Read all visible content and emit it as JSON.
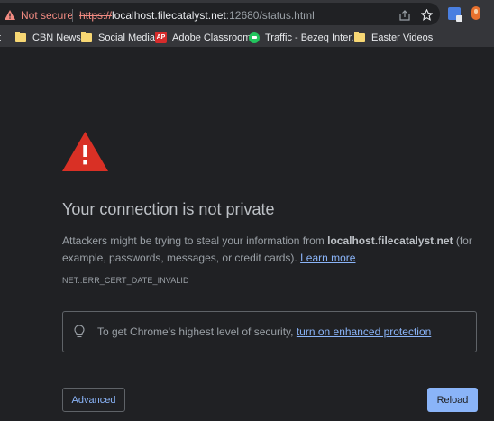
{
  "address_bar": {
    "security_label": "Not secure",
    "url_scheme": "https://",
    "url_host": "localhost.filecatalyst.net",
    "url_rest": ":12680/status.html",
    "icons": [
      "warning-icon",
      "share-icon",
      "star-icon",
      "translate-extension-icon",
      "extension-icon"
    ]
  },
  "bookmarks": [
    {
      "label": "t",
      "icon": "folder-icon"
    },
    {
      "label": "CBN News",
      "icon": "folder-icon"
    },
    {
      "label": "Social Media",
      "icon": "folder-icon"
    },
    {
      "label": "Adobe Classroom",
      "icon": "adobe-icon",
      "icon_text": "AP"
    },
    {
      "label": "Traffic - Bezeq Inter...",
      "icon": "chat-icon"
    },
    {
      "label": "Easter Videos",
      "icon": "folder-icon"
    }
  ],
  "interstitial": {
    "title": "Your connection is not private",
    "desc_pre": "Attackers might be trying to steal your information from ",
    "desc_host": "localhost.filecatalyst.net",
    "desc_post": " (for example, passwords, messages, or credit cards). ",
    "learn_more": "Learn more",
    "error_code": "NET::ERR_CERT_DATE_INVALID",
    "enhanced_prefix": "To get Chrome's highest level of security, ",
    "enhanced_link": "turn on enhanced protection",
    "advanced_label": "Advanced",
    "reload_label": "Reload"
  },
  "colors": {
    "background": "#202124",
    "warning_red": "#d93025",
    "link_blue": "#8ab4f8"
  }
}
